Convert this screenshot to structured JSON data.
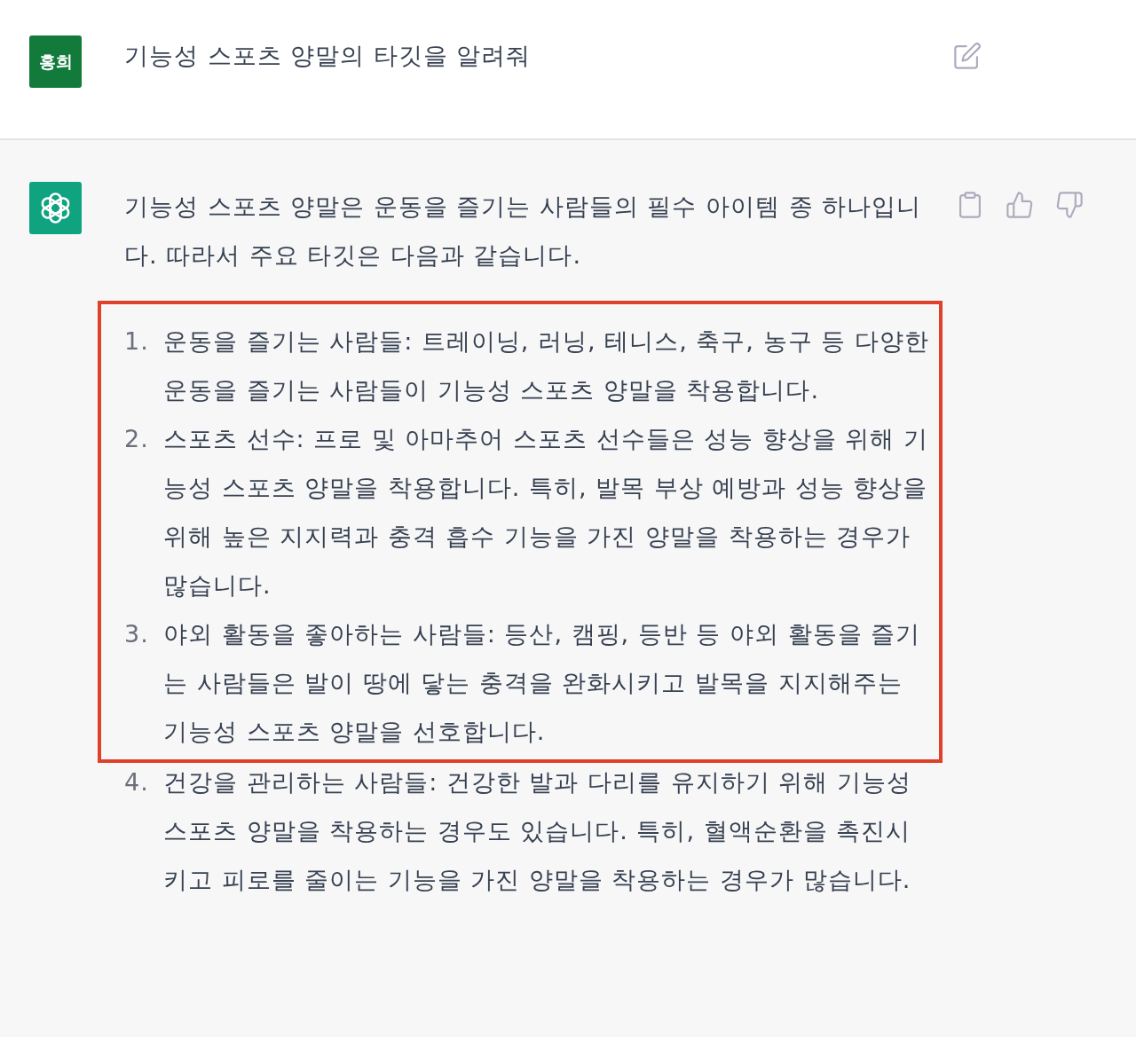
{
  "user_message": {
    "avatar_initials": "홍희",
    "text": "기능성 스포츠 양말의 타깃을 알려줘"
  },
  "assistant_message": {
    "intro": "기능성 스포츠 양말은 운동을 즐기는 사람들의 필수 아이템 종 하나입니다. 따라서 주요 타깃은 다음과 같습니다.",
    "list": [
      {
        "number": "1.",
        "text": "운동을 즐기는 사람들: 트레이닝, 러닝, 테니스, 축구, 농구 등 다양한 운동을 즐기는 사람들이 기능성 스포츠 양말을 착용합니다.",
        "highlighted": true
      },
      {
        "number": "2.",
        "text": "스포츠 선수: 프로 및 아마추어 스포츠 선수들은 성능 향상을 위해 기능성 스포츠 양말을 착용합니다. 특히, 발목 부상 예방과 성능 향상을 위해 높은 지지력과 충격 흡수 기능을 가진 양말을 착용하는 경우가 많습니다.",
        "highlighted": true
      },
      {
        "number": "3.",
        "text": "야외 활동을 좋아하는 사람들: 등산, 캠핑, 등반 등 야외 활동을 즐기는 사람들은 발이 땅에 닿는 충격을 완화시키고 발목을 지지해주는 기능성 스포츠 양말을 선호합니다.",
        "highlighted": true
      },
      {
        "number": "4.",
        "text": "건강을 관리하는 사람들: 건강한 발과 다리를 유지하기 위해 기능성 스포츠 양말을 착용하는 경우도 있습니다. 특히, 혈액순환을 촉진시키고 피로를 줄이는 기능을 가진 양말을 착용하는 경우가 많습니다.",
        "highlighted": false
      }
    ]
  }
}
